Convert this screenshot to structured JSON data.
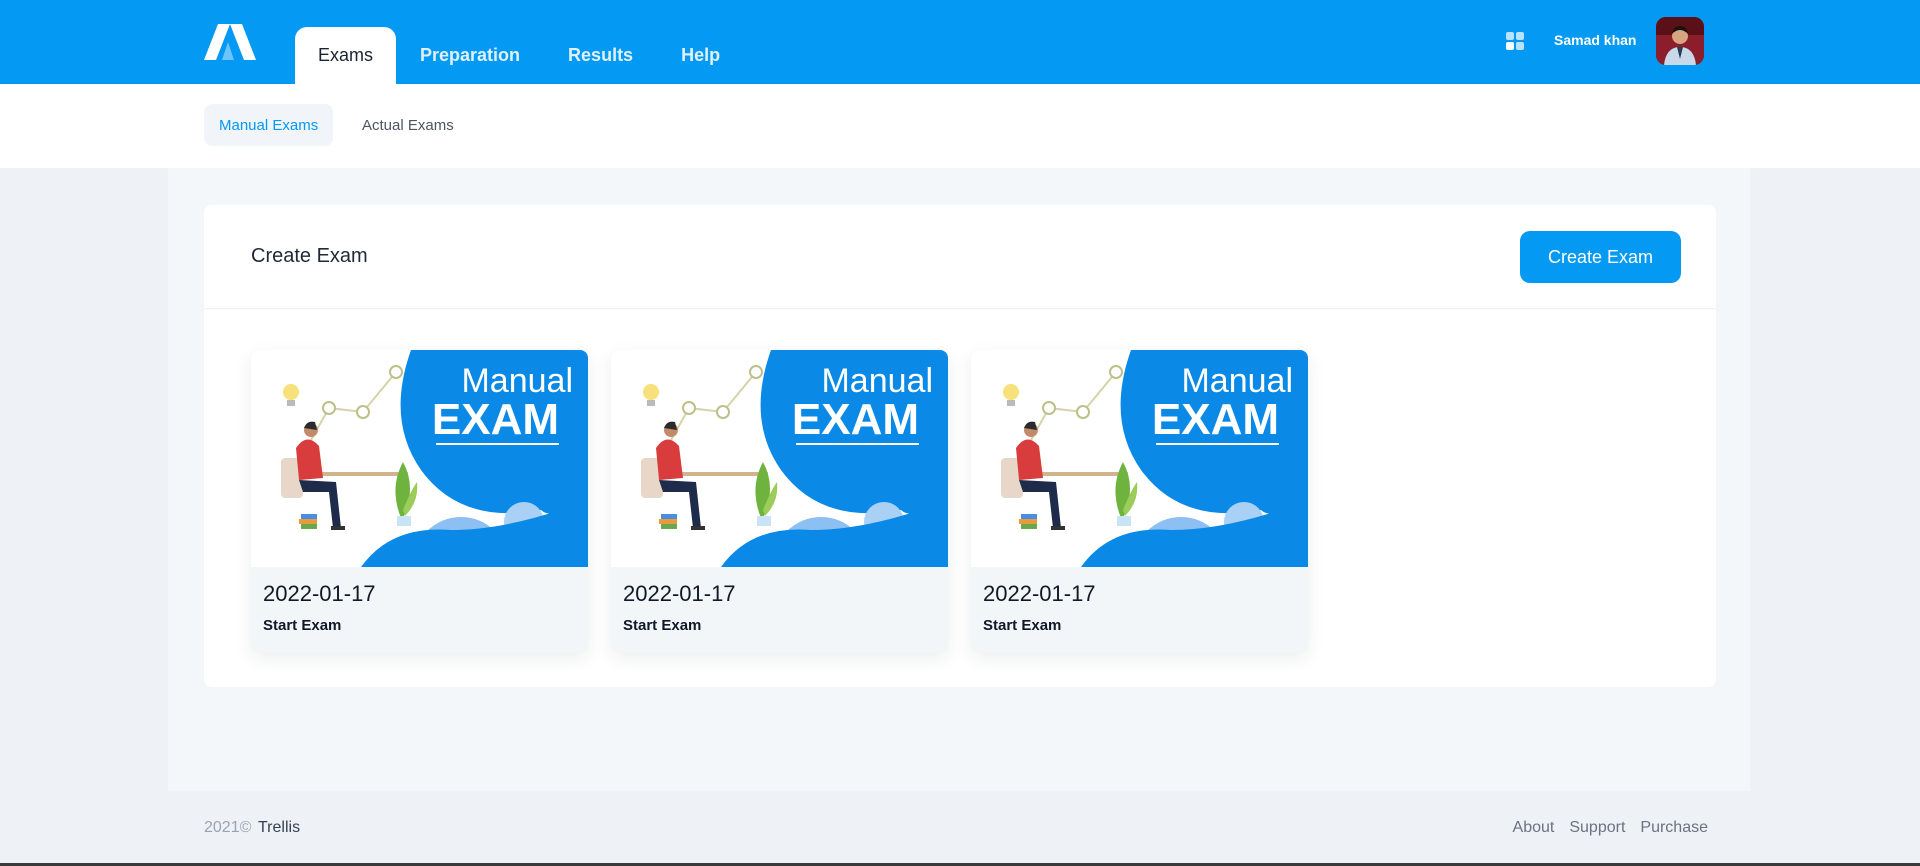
{
  "colors": {
    "primary": "#0499f2",
    "page_bg": "#eef2f7",
    "card_bg": "#ffffff",
    "exam_card_bg": "#f3f6f9"
  },
  "header": {
    "logo_icon": "brand-logo-icon",
    "tabs": [
      {
        "label": "Exams",
        "active": true
      },
      {
        "label": "Preparation",
        "active": false
      },
      {
        "label": "Results",
        "active": false
      },
      {
        "label": "Help",
        "active": false
      }
    ],
    "apps_icon": "grid-icon",
    "user_name": "Samad khan",
    "avatar_icon": "user-avatar"
  },
  "subnav": {
    "tabs": [
      {
        "label": "Manual Exams",
        "active": true
      },
      {
        "label": "Actual Exams",
        "active": false
      }
    ]
  },
  "main": {
    "title": "Create Exam",
    "create_button_label": "Create Exam",
    "thumbnail_text": {
      "line1": "Manual",
      "line2": "EXAM"
    },
    "exams": [
      {
        "date": "2022-01-17",
        "action": "Start Exam"
      },
      {
        "date": "2022-01-17",
        "action": "Start Exam"
      },
      {
        "date": "2022-01-17",
        "action": "Start Exam"
      }
    ]
  },
  "footer": {
    "year": "2021©",
    "brand": "Trellis",
    "links": [
      "About",
      "Support",
      "Purchase"
    ]
  }
}
